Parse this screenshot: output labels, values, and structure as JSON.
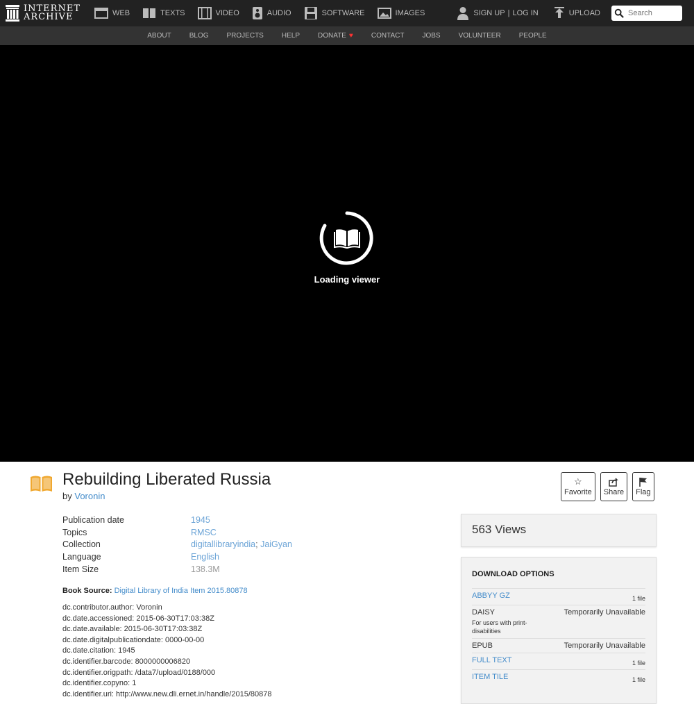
{
  "logo": {
    "line1": "INTERNET",
    "line2": "ARCHIVE"
  },
  "nav": [
    {
      "label": "WEB",
      "icon": "web-icon"
    },
    {
      "label": "TEXTS",
      "icon": "texts-icon"
    },
    {
      "label": "VIDEO",
      "icon": "video-icon"
    },
    {
      "label": "AUDIO",
      "icon": "audio-icon"
    },
    {
      "label": "SOFTWARE",
      "icon": "software-icon"
    },
    {
      "label": "IMAGES",
      "icon": "images-icon"
    }
  ],
  "user": {
    "signup": "SIGN UP",
    "separator": "|",
    "login": "LOG IN",
    "upload": "UPLOAD"
  },
  "search": {
    "placeholder": "Search"
  },
  "subnav": [
    "ABOUT",
    "BLOG",
    "PROJECTS",
    "HELP",
    "DONATE",
    "CONTACT",
    "JOBS",
    "VOLUNTEER",
    "PEOPLE"
  ],
  "viewer": {
    "loading": "Loading viewer"
  },
  "item": {
    "title": "Rebuilding Liberated Russia",
    "by": "by",
    "author": "Voronin",
    "actions": {
      "favorite": "Favorite",
      "share": "Share",
      "flag": "Flag"
    }
  },
  "metadata": {
    "publication_date": {
      "key": "Publication date",
      "value": "1945"
    },
    "topics": {
      "key": "Topics",
      "value": "RMSC"
    },
    "collection": {
      "key": "Collection",
      "value1": "digitallibraryindia",
      "sep": ";",
      "value2": "JaiGyan"
    },
    "language": {
      "key": "Language",
      "value": "English"
    },
    "item_size": {
      "key": "Item Size",
      "value": "138.3M"
    }
  },
  "book_source": {
    "label": "Book Source:",
    "link": "Digital Library of India Item 2015.80878"
  },
  "dc": [
    "dc.contributor.author: Voronin",
    "dc.date.accessioned: 2015-06-30T17:03:38Z",
    "dc.date.available: 2015-06-30T17:03:38Z",
    "dc.date.digitalpublicationdate: 0000-00-00",
    "dc.date.citation: 1945",
    "dc.identifier.barcode: 8000000006820",
    "dc.identifier.origpath: /data7/upload/0188/000",
    "dc.identifier.copyno: 1",
    "dc.identifier.uri: http://www.new.dli.ernet.in/handle/2015/80878"
  ],
  "views": "563 Views",
  "downloads": {
    "title": "DOWNLOAD OPTIONS",
    "abbyy": {
      "name": "ABBYY GZ",
      "count": "1 file"
    },
    "daisy": {
      "name": "DAISY",
      "note": "For users with print-disabilities",
      "status": "Temporarily Unavailable"
    },
    "epub": {
      "name": "EPUB",
      "status": "Temporarily Unavailable"
    },
    "fulltext": {
      "name": "FULL TEXT",
      "count": "1 file"
    },
    "itemtile": {
      "name": "ITEM TILE",
      "count": "1 file"
    }
  }
}
